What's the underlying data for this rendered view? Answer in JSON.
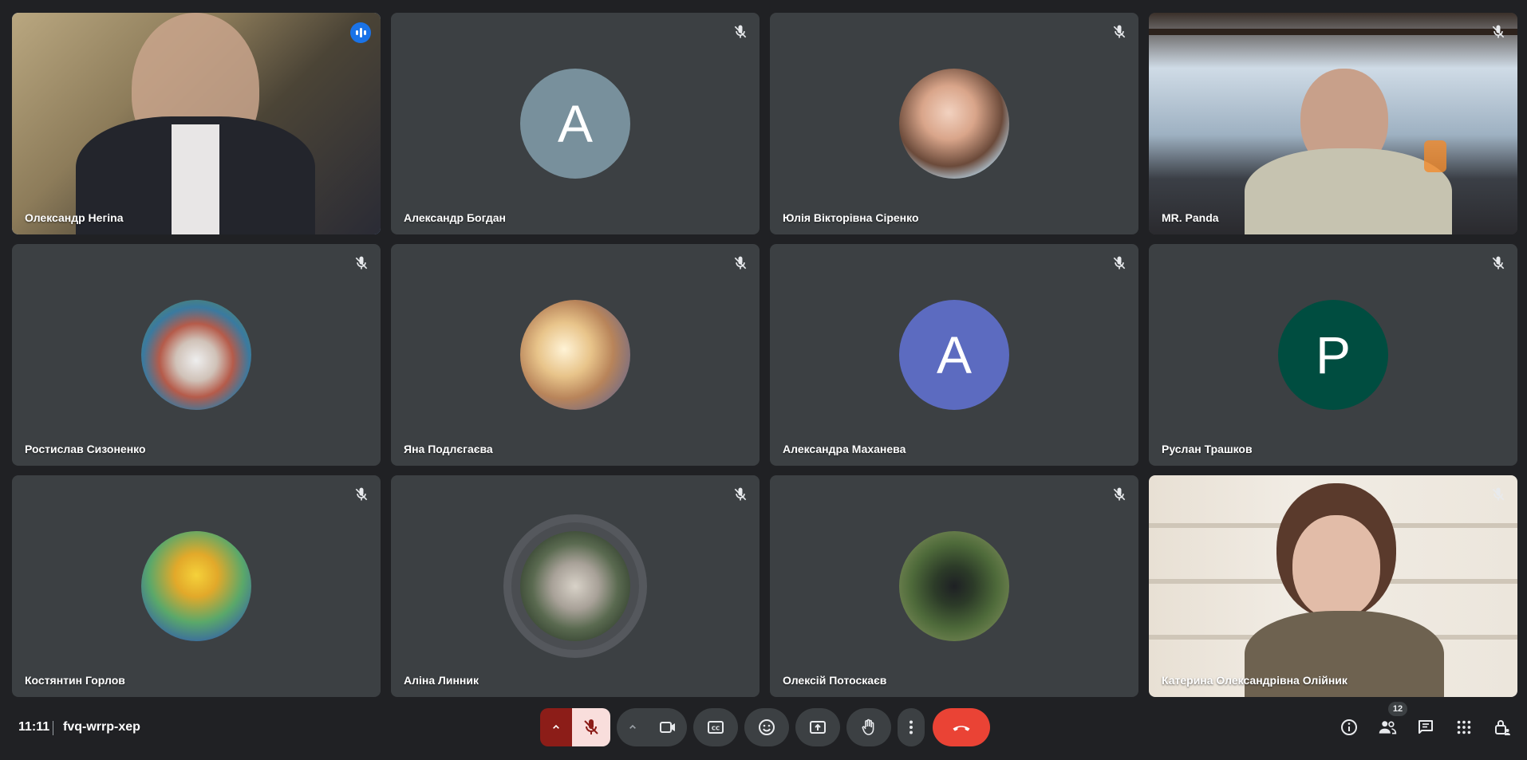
{
  "participants": [
    {
      "name": "Олександр Негіna",
      "type": "video",
      "speaking": true
    },
    {
      "name": "Александр Богдан",
      "type": "letter",
      "letter": "A",
      "color": "#78909c"
    },
    {
      "name": "Юлія Вікторівна Сіренко",
      "type": "photo"
    },
    {
      "name": "MR. Panda",
      "type": "video"
    },
    {
      "name": "Ростислав Сизоненко",
      "type": "photo"
    },
    {
      "name": "Яна Подлєгаєва",
      "type": "photo"
    },
    {
      "name": "Александра Маханева",
      "type": "letter",
      "letter": "A",
      "color": "#5c6bc0"
    },
    {
      "name": "Руслан Трашков",
      "type": "letter",
      "letter": "P",
      "color": "#004d40"
    },
    {
      "name": "Костянтин Горлов",
      "type": "photo"
    },
    {
      "name": "Аліна Линник",
      "type": "photo",
      "ring": true
    },
    {
      "name": "Олексій Потоскаєв",
      "type": "photo"
    },
    {
      "name": "Катерина Олександрівна Олійник",
      "type": "video"
    }
  ],
  "meeting": {
    "time": "11:11",
    "code": "fvq-wrrp-xep",
    "participant_count": "12"
  },
  "colors": {
    "accent": "#8ab4f8",
    "hangup": "#ea4335",
    "mic_off_bg": "#f9dedc"
  }
}
